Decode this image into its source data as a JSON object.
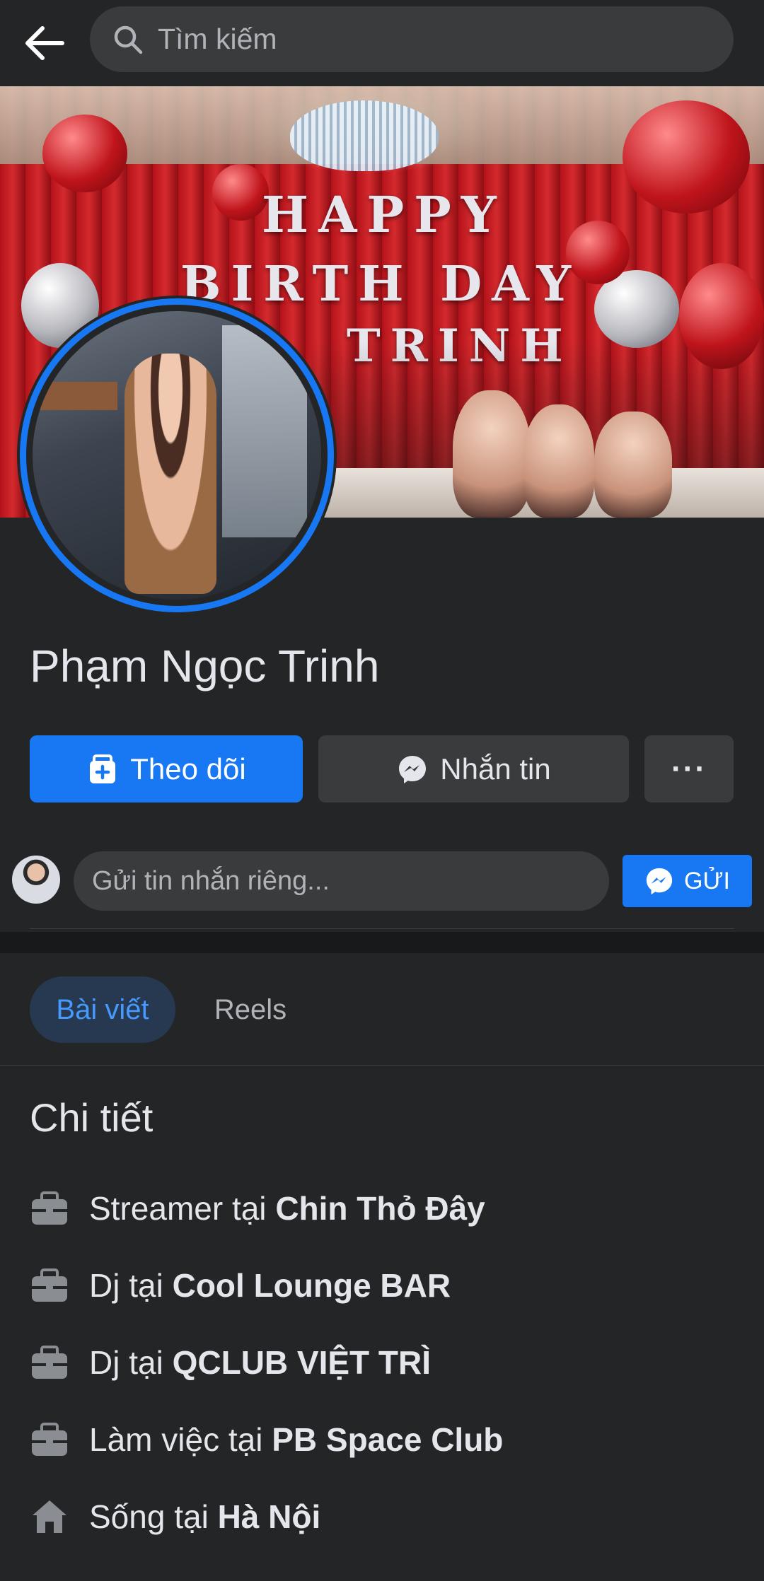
{
  "search": {
    "placeholder": "Tìm kiếm"
  },
  "cover": {
    "banner_line1": "HAPPY",
    "banner_line2": "BIRTH DAY",
    "banner_line3": "TRINH"
  },
  "profile": {
    "name": "Phạm Ngọc Trinh"
  },
  "actions": {
    "follow_label": "Theo dõi",
    "message_label": "Nhắn tin",
    "more_label": "···"
  },
  "private_message": {
    "placeholder": "Gửi tin nhắn riêng...",
    "send_label": "GỬI"
  },
  "tabs": [
    {
      "label": "Bài viết",
      "active": true
    },
    {
      "label": "Reels",
      "active": false
    }
  ],
  "details": {
    "title": "Chi tiết",
    "items": [
      {
        "icon": "briefcase-icon",
        "prefix": "Streamer tại ",
        "value": "Chin Thỏ Đây"
      },
      {
        "icon": "briefcase-icon",
        "prefix": "Dj tại ",
        "value": "Cool Lounge BAR"
      },
      {
        "icon": "briefcase-icon",
        "prefix": "Dj tại ",
        "value": "QCLUB VIỆT TRÌ"
      },
      {
        "icon": "briefcase-icon",
        "prefix": "Làm việc tại ",
        "value": "PB Space Club"
      },
      {
        "icon": "home-icon",
        "prefix": "Sống tại ",
        "value": "Hà Nội"
      }
    ]
  },
  "colors": {
    "background": "#242526",
    "accent": "#1877f2",
    "active_tab_bg": "#263951",
    "active_tab_text": "#4599ff",
    "secondary_button": "#3a3b3c"
  }
}
